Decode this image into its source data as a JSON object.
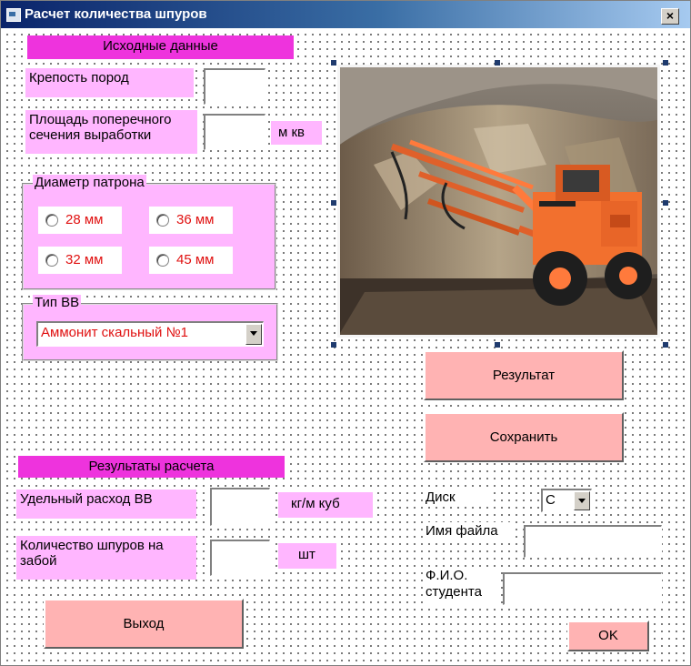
{
  "window": {
    "title": "Расчет количества шпуров",
    "close_label": "×"
  },
  "inputs_section": {
    "header": "Исходные данные",
    "rock_strength_label": "Крепость пород",
    "area_label": "Площадь поперечного сечения выработки",
    "area_unit": "м кв"
  },
  "cartridge_group": {
    "title": "Диаметр патрона",
    "options": [
      "28 мм",
      "36 мм",
      "32 мм",
      "45 мм"
    ]
  },
  "explosive_group": {
    "title": "Тип ВВ",
    "selected": "Аммонит скальный №1"
  },
  "results_section": {
    "header": "Результаты расчета",
    "consumption_label": "Удельный расход ВВ",
    "consumption_unit": "кг/м куб",
    "holes_label": "Количество шпуров на забой",
    "holes_unit": "шт"
  },
  "buttons": {
    "result": "Результат",
    "save": "Сохранить",
    "exit": "Выход",
    "ok": "OK"
  },
  "save_section": {
    "disk_label": "Диск",
    "disk_value": "C",
    "file_label": "Имя файла",
    "student_label": "Ф.И.О. студента"
  },
  "colors": {
    "pink": "#ffb6ff",
    "magenta": "#ee33dd",
    "button_pink": "#ffb3b3",
    "red_text": "#e01010"
  }
}
